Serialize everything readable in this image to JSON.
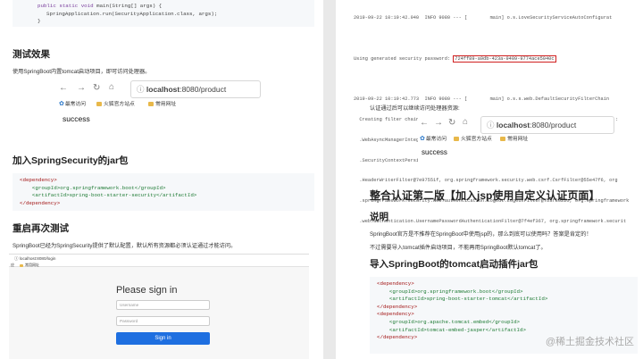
{
  "left": {
    "code_top": {
      "line1_kw": "public static void",
      "line1_rest": " main(String[] args) {",
      "line2": "SpringApplication.run(SecurityApplication.class, args);",
      "line3": "}"
    },
    "section1": {
      "heading": "测试效果",
      "text": "使用SpringBoot内置tomcat启动项目，即可访问处理器。",
      "browser": {
        "url_host": "localhost",
        "url_path": ":8080/product",
        "bookmark1": "最常访问",
        "bookmark2": "火狐官方站点",
        "bookmark3": "常用网址",
        "result": "success"
      }
    },
    "section2": {
      "heading": "加入SpringSecurity的jar包",
      "code": [
        "<dependency>",
        "    <groupId>org.springframework.boot</groupId>",
        "    <artifactId>spring-boot-starter-security</artifactId>",
        "</dependency>"
      ]
    },
    "section3": {
      "heading": "重启再次测试",
      "text": "SpringBoot已经为SpringSecurity提供了默认配置，默认所有资源都必须认证通过才能访问。",
      "login": {
        "url": "localhost:8080/login",
        "bm1": "应",
        "bm2": "常用网址",
        "title": "Please sign in",
        "username_placeholder": "Username",
        "password_placeholder": "Password",
        "button": "Sign in"
      }
    }
  },
  "right": {
    "log_top": [
      "2019-09-22 10:19:42.940  INFO 9080 --- [        main] o.s.LoveSecurityServiceAutoConfigurat",
      "",
      "Using generated security password: ",
      "",
      "2019-09-22 10:19:42.773  INFO 9080 --- [        main] o.s.s.web.DefaultSecurityFilterChain",
      "  Creating filter chain: any request, [org.springframework.security.web.context.request.async",
      "  .WebAsyncManagerIntegrationFilter@5a4c4ffc, org.springframework.security.web.context",
      "  .SecurityContextPersistenceFilter@3e6f5fea, org.springframework.security.web.header",
      "  .HeaderWriterFilter@7e97551f, org.springframework.security.web.csrf.CsrfFilter@55e47f6, org",
      "  .springframework.security.web.authentication.logout.LogoutFilter@7b3f8022c, org.springframework",
      "  .web.authentication.UsernamePasswordAuthenticationFilter@7f4ef367, org.springframework.securit"
    ],
    "password": "724ff89-a9db-423a-9409-9774ace5040c",
    "auth_text": "认证通过后可以继续访问处理器资源:",
    "browser": {
      "url_host": "localhost",
      "url_path": ":8080/product",
      "bookmark1": "最常访问",
      "bookmark2": "火狐官方站点",
      "bookmark3": "常用网址",
      "result": "success"
    },
    "title": "整合认证第二版【加入jsp使用自定义认证页面】",
    "section1": {
      "heading": "说明",
      "text1": "SpringBoot官方是不推荐在SpringBoot中使用jsp的，那么到底可以使用吗？答案是肯定的！",
      "text2": "不过需要导入tomcat插件启动项目，不能再用SpringBoot默认tomcat了。"
    },
    "section2": {
      "heading": "导入SpringBoot的tomcat启动插件jar包",
      "code": [
        "<dependency>",
        "    <groupId>org.springframework.boot</groupId>",
        "    <artifactId>spring-boot-starter-tomcat</artifactId>",
        "</dependency>",
        "<dependency>",
        "    <groupId>org.apache.tomcat.embed</groupId>",
        "    <artifactId>tomcat-embed-jasper</artifactId>",
        "</dependency>"
      ]
    },
    "watermark": "@稀土掘金技术社区"
  }
}
